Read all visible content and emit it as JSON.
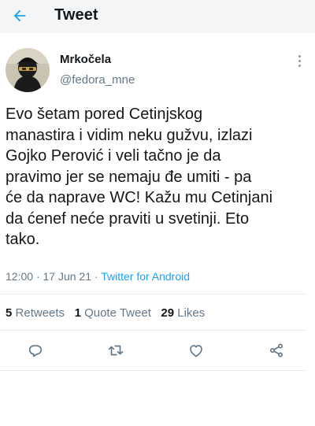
{
  "header": {
    "title": "Tweet",
    "back_icon": "arrow-left-icon",
    "accent_color": "#1da1f2"
  },
  "tweet": {
    "author_name": "Mrkočela",
    "author_handle": "@fedora_mne",
    "text": "Evo šetam pored Cetinjskog\nmanastira i vidim neku gužvu, izlazi\nGojko Perović i veli tačno je da\npravimo jer se nemaju đe umiti - pa\nće da naprave WC! Kažu mu Cetinjani\nda ćenef neće praviti u svetinji. Eto\ntako.",
    "time": "12:00",
    "date": "17 Jun 21",
    "separator": "·",
    "source": "Twitter for Android"
  },
  "stats": {
    "retweets_count": "5",
    "retweets_label": "Retweets",
    "quotes_count": "1",
    "quotes_label": "Quote Tweet",
    "likes_count": "29",
    "likes_label": "Likes"
  },
  "actions": {
    "icons": [
      "reply-icon",
      "retweet-icon",
      "like-icon",
      "share-icon"
    ],
    "icon_color": "#657786"
  }
}
